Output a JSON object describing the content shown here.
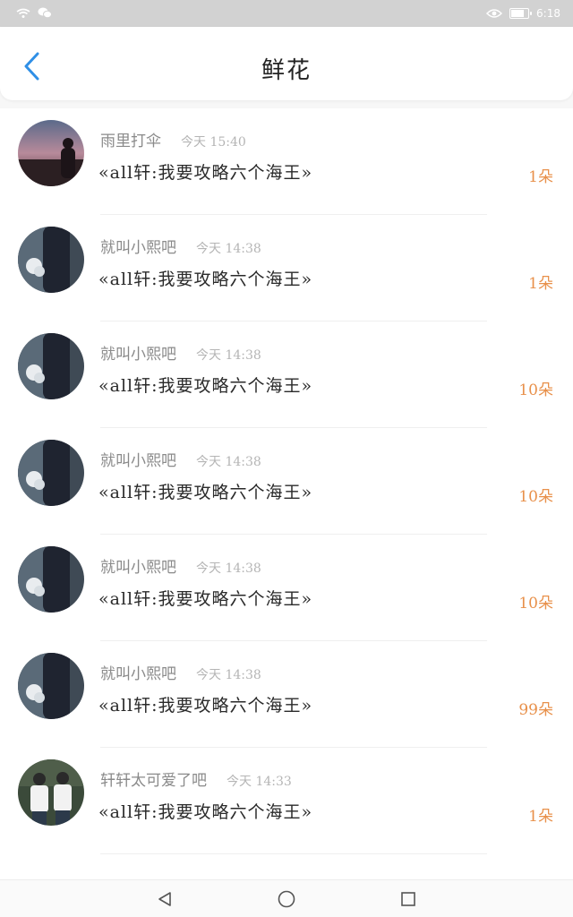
{
  "status_bar": {
    "time": "6:18",
    "battery_level": 0.8
  },
  "header": {
    "title": "鲜花"
  },
  "items": [
    {
      "sender": "雨里打伞",
      "time": "今天 15:40",
      "title": "«all轩:我要攻略六个海王»",
      "count": "1朵",
      "avatar": "sunset-avatar"
    },
    {
      "sender": "就叫小熙吧",
      "time": "今天 14:38",
      "title": "«all轩:我要攻略六个海王»",
      "count": "1朵",
      "avatar": "flower-avatar"
    },
    {
      "sender": "就叫小熙吧",
      "time": "今天 14:38",
      "title": "«all轩:我要攻略六个海王»",
      "count": "10朵",
      "avatar": "flower-avatar"
    },
    {
      "sender": "就叫小熙吧",
      "time": "今天 14:38",
      "title": "«all轩:我要攻略六个海王»",
      "count": "10朵",
      "avatar": "flower-avatar"
    },
    {
      "sender": "就叫小熙吧",
      "time": "今天 14:38",
      "title": "«all轩:我要攻略六个海王»",
      "count": "10朵",
      "avatar": "flower-avatar"
    },
    {
      "sender": "就叫小熙吧",
      "time": "今天 14:38",
      "title": "«all轩:我要攻略六个海王»",
      "count": "99朵",
      "avatar": "flower-avatar"
    },
    {
      "sender": "轩轩太可爱了吧",
      "time": "今天 14:33",
      "title": "«all轩:我要攻略六个海王»",
      "count": "1朵",
      "avatar": "pair-avatar"
    }
  ],
  "colors": {
    "accent": "#2f8fe6",
    "count": "#e8904a"
  }
}
